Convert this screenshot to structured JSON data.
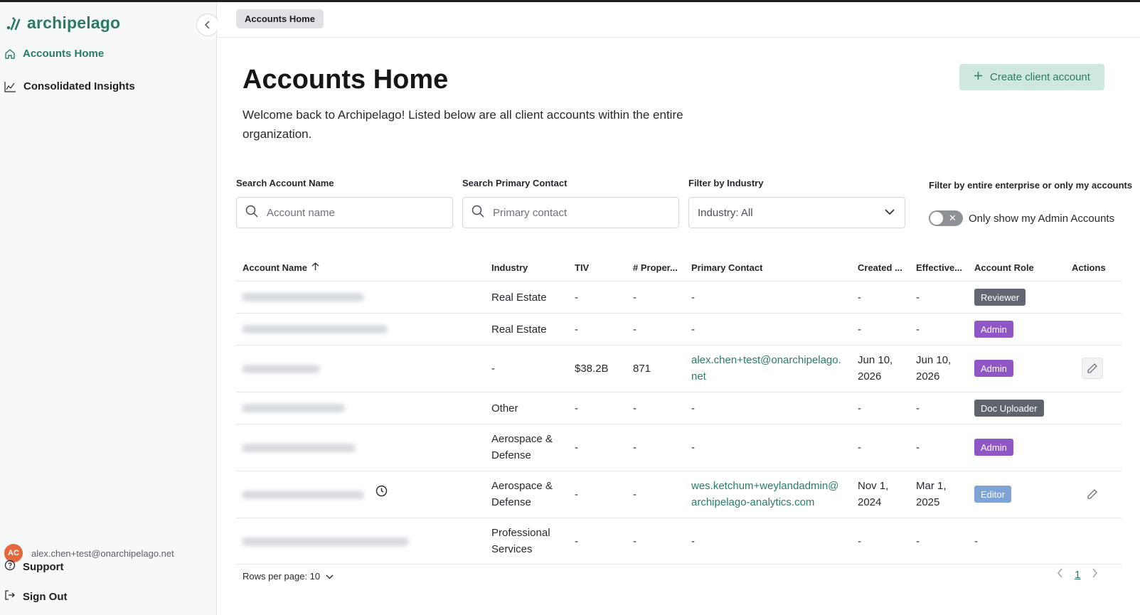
{
  "app": {
    "logo_text": "archipelago",
    "brand_color": "#2b7a66"
  },
  "sidebar": {
    "items": [
      {
        "label": "Accounts Home",
        "icon": "home-icon",
        "active": true
      },
      {
        "label": "Consolidated Insights",
        "icon": "chart-line-icon",
        "active": false
      }
    ],
    "user": {
      "initials": "AC",
      "email": "alex.chen+test@onarchipelago.net"
    },
    "support_label": "Support",
    "signout_label": "Sign Out"
  },
  "breadcrumb": {
    "label": "Accounts Home"
  },
  "page": {
    "title": "Accounts Home",
    "description": "Welcome back to Archipelago! Listed below are all client accounts within the entire organization.",
    "create_label": "Create client account"
  },
  "filters": {
    "account_label": "Search Account Name",
    "account_placeholder": "Account name",
    "contact_label": "Search Primary Contact",
    "contact_placeholder": "Primary contact",
    "industry_label": "Filter by Industry",
    "industry_value": "Industry: All",
    "scope_label": "Filter by entire enterprise or only my accounts",
    "toggle_label": "Only show my Admin Accounts",
    "toggle_on": false
  },
  "table": {
    "headers": {
      "account_name": "Account Name",
      "industry": "Industry",
      "tiv": "TIV",
      "properties": "# Proper...",
      "contact": "Primary Contact",
      "created": "Created ...",
      "effective": "Effective...",
      "role": "Account Role",
      "actions": "Actions"
    },
    "rows": [
      {
        "industry": "Real Estate",
        "tiv": "-",
        "properties": "-",
        "contact": "-",
        "created": "-",
        "effective": "-",
        "role": "Reviewer"
      },
      {
        "industry": "Real Estate",
        "tiv": "-",
        "properties": "-",
        "contact": "-",
        "created": "-",
        "effective": "-",
        "role": "Admin"
      },
      {
        "industry": "-",
        "tiv": "$38.2B",
        "properties": "871",
        "contact": "alex.chen+test@onarchipelago.\nnet",
        "created": "Jun 10,\n2026",
        "effective": "Jun 10,\n2026",
        "role": "Admin"
      },
      {
        "industry": "Other",
        "tiv": "-",
        "properties": "-",
        "contact": "-",
        "created": "-",
        "effective": "-",
        "role": "Doc Uploader"
      },
      {
        "industry": "Aerospace &\nDefense",
        "tiv": "-",
        "properties": "-",
        "contact": "-",
        "created": "-",
        "effective": "-",
        "role": "Admin"
      },
      {
        "industry": "Aerospace &\nDefense",
        "tiv": "-",
        "properties": "-",
        "contact": "wes.ketchum+weylandadmin@\narchipelago-analytics.com",
        "created": "Nov 1,\n2024",
        "effective": "Mar 1,\n2025",
        "role": "Editor"
      },
      {
        "industry": "Professional\nServices",
        "tiv": "-",
        "properties": "-",
        "contact": "-",
        "created": "-",
        "effective": "-",
        "role": "-"
      }
    ]
  },
  "pagination": {
    "rows_per_page": "Rows per page: 10",
    "current_page": "1"
  }
}
